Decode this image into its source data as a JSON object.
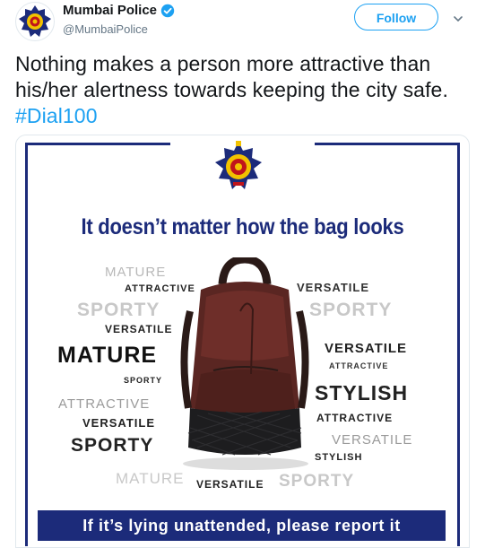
{
  "tweet": {
    "author_name": "Mumbai Police",
    "author_handle": "@MumbaiPolice",
    "follow_label": "Follow",
    "text_main": "Nothing makes a person more attractive than his/her alertness towards keeping the city safe. ",
    "hashtag": "#Dial100"
  },
  "poster": {
    "headline": "It doesn’t matter how the bag looks",
    "banner": "If it’s lying unattended, please report it",
    "words": [
      {
        "text": "MATURE",
        "color": "#b8b8b8"
      },
      {
        "text": "ATTRACTIVE",
        "color": "#222222"
      },
      {
        "text": "SPORTY",
        "color": "#c8c8c8"
      },
      {
        "text": "VERSATILE",
        "color": "#222222"
      },
      {
        "text": "MATURE",
        "color": "#111111"
      },
      {
        "text": "SPORTY",
        "color": "#222222"
      },
      {
        "text": "ATTRACTIVE",
        "color": "#9a9a9a"
      },
      {
        "text": "VERSATILE",
        "color": "#222222"
      },
      {
        "text": "SPORTY",
        "color": "#222222"
      },
      {
        "text": "MATURE",
        "color": "#c8c8c8"
      },
      {
        "text": "VERSATILE",
        "color": "#222222"
      },
      {
        "text": "SPORTY",
        "color": "#c8c8c8"
      },
      {
        "text": "SPORTY",
        "color": "#222222"
      },
      {
        "text": "VERSATILE",
        "color": "#333333"
      },
      {
        "text": "ATTRACTIVE",
        "color": "#333333"
      },
      {
        "text": "STYLISH",
        "color": "#222222"
      },
      {
        "text": "ATTRACTIVE",
        "color": "#222222"
      },
      {
        "text": "VERSATILE",
        "color": "#9a9a9a"
      },
      {
        "text": "STYLISH",
        "color": "#222222"
      },
      {
        "text": "VERSATILE",
        "color": "#222222"
      }
    ]
  },
  "colors": {
    "accent": "#1da1f2",
    "poster_blue": "#1c2b7a",
    "text": "#14171a",
    "muted": "#657786"
  },
  "icons": {
    "avatar": "police-emblem-icon",
    "verified": "verified-badge-icon",
    "caret": "chevron-down-icon"
  }
}
